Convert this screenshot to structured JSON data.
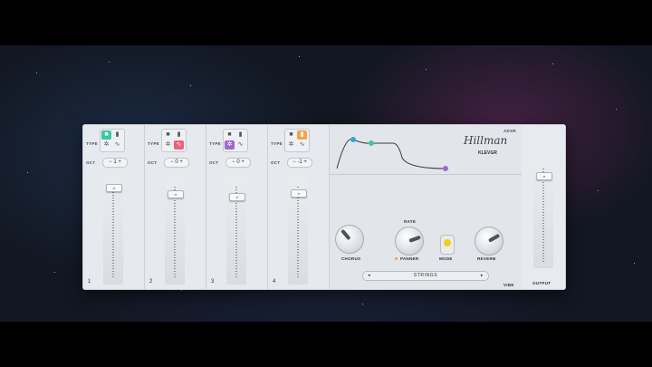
{
  "channels": [
    {
      "number": "1",
      "type_label": "TYPE",
      "oct_label": "OCT",
      "oct_value": "− 1 +",
      "accent": "#3ec7a6",
      "accent_cell": "top-left"
    },
    {
      "number": "2",
      "type_label": "TYPE",
      "oct_label": "OCT",
      "oct_value": "− 0 +",
      "accent": "#f0607a",
      "accent_cell": "bottom-right"
    },
    {
      "number": "3",
      "type_label": "TYPE",
      "oct_label": "OCT",
      "oct_value": "− 0 +",
      "accent": "#9b6bd1",
      "accent_cell": "bottom-left"
    },
    {
      "number": "4",
      "type_label": "TYPE",
      "oct_label": "OCT",
      "oct_value": "− -1 +",
      "accent": "#f5a348",
      "accent_cell": "top-right"
    }
  ],
  "envelope": {
    "label": "ADSR",
    "colors": [
      "#2ea8d8",
      "#3ec79a",
      "#9b6bd1"
    ]
  },
  "knobs": {
    "chorus": "CHORUS",
    "rate": "RATE",
    "panner": "PANNER",
    "mode": "MODE",
    "reverb": "REVERB",
    "mode_accent": "#f2cf1d"
  },
  "preset": {
    "name": "STRINGS",
    "label": "VIBE"
  },
  "output": {
    "label": "OUTPUT"
  },
  "brand": {
    "signature": "Hillman",
    "maker": "KLEVGR"
  }
}
